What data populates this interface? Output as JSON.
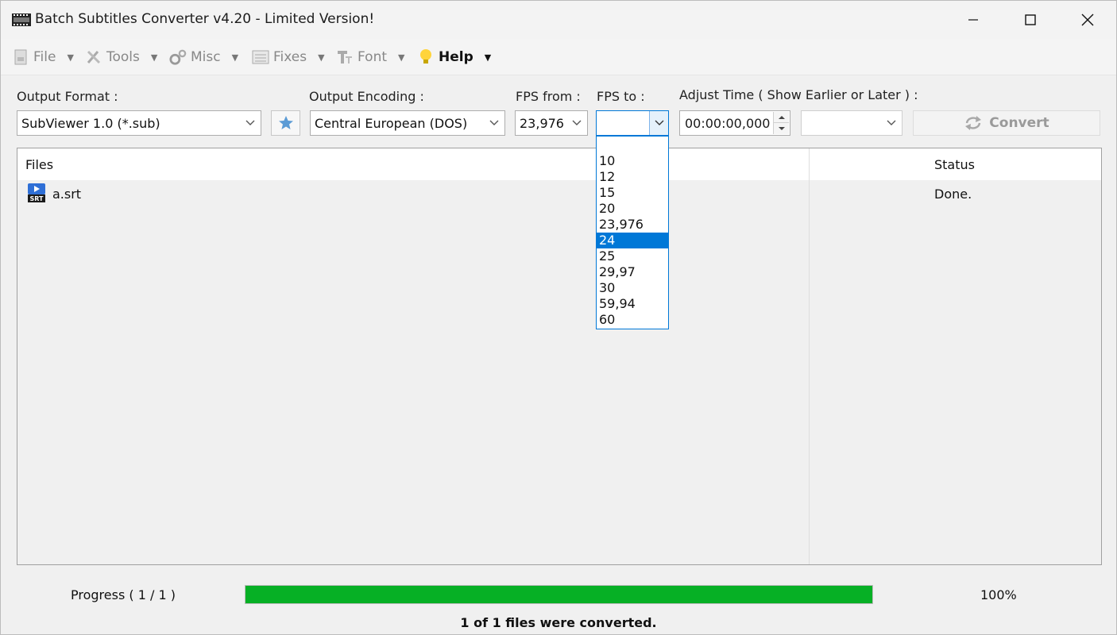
{
  "window": {
    "title": "Batch Subtitles Converter v4.20 - Limited Version!"
  },
  "menu": {
    "items": [
      {
        "label": "File",
        "icon": "file-icon"
      },
      {
        "label": "Tools",
        "icon": "tools-icon"
      },
      {
        "label": "Misc",
        "icon": "gears-icon"
      },
      {
        "label": "Fixes",
        "icon": "list-icon"
      },
      {
        "label": "Font",
        "icon": "font-icon"
      },
      {
        "label": "Help",
        "icon": "lightbulb-icon"
      }
    ]
  },
  "toolbar": {
    "output_format_label": "Output Format :",
    "output_format_value": "SubViewer 1.0 (*.sub)",
    "output_encoding_label": "Output Encoding :",
    "output_encoding_value": "Central European (DOS)",
    "fps_from_label": "FPS from :",
    "fps_from_value": "23,976",
    "fps_to_label": "FPS to :",
    "fps_to_value": "",
    "adjust_time_label": "Adjust Time ( Show Earlier or Later ) :",
    "adjust_time_value": "00:00:00,000",
    "adjust_unit_value": "",
    "convert_label": "Convert"
  },
  "fps_to_options": [
    "",
    "10",
    "12",
    "15",
    "20",
    "23,976",
    "24",
    "25",
    "29,97",
    "30",
    "59,94",
    "60"
  ],
  "fps_to_highlighted": "24",
  "files_list": {
    "columns": {
      "files": "Files",
      "status": "Status"
    },
    "rows": [
      {
        "name": "a.srt",
        "status": "Done.",
        "icon": "srt-file-icon"
      }
    ]
  },
  "progress": {
    "label": "Progress ( 1 / 1 )",
    "percent_text": "100%",
    "fraction": 1.0,
    "message": "1 of 1 files were converted."
  },
  "colors": {
    "accent": "#0078d7",
    "progress": "#06b025"
  }
}
